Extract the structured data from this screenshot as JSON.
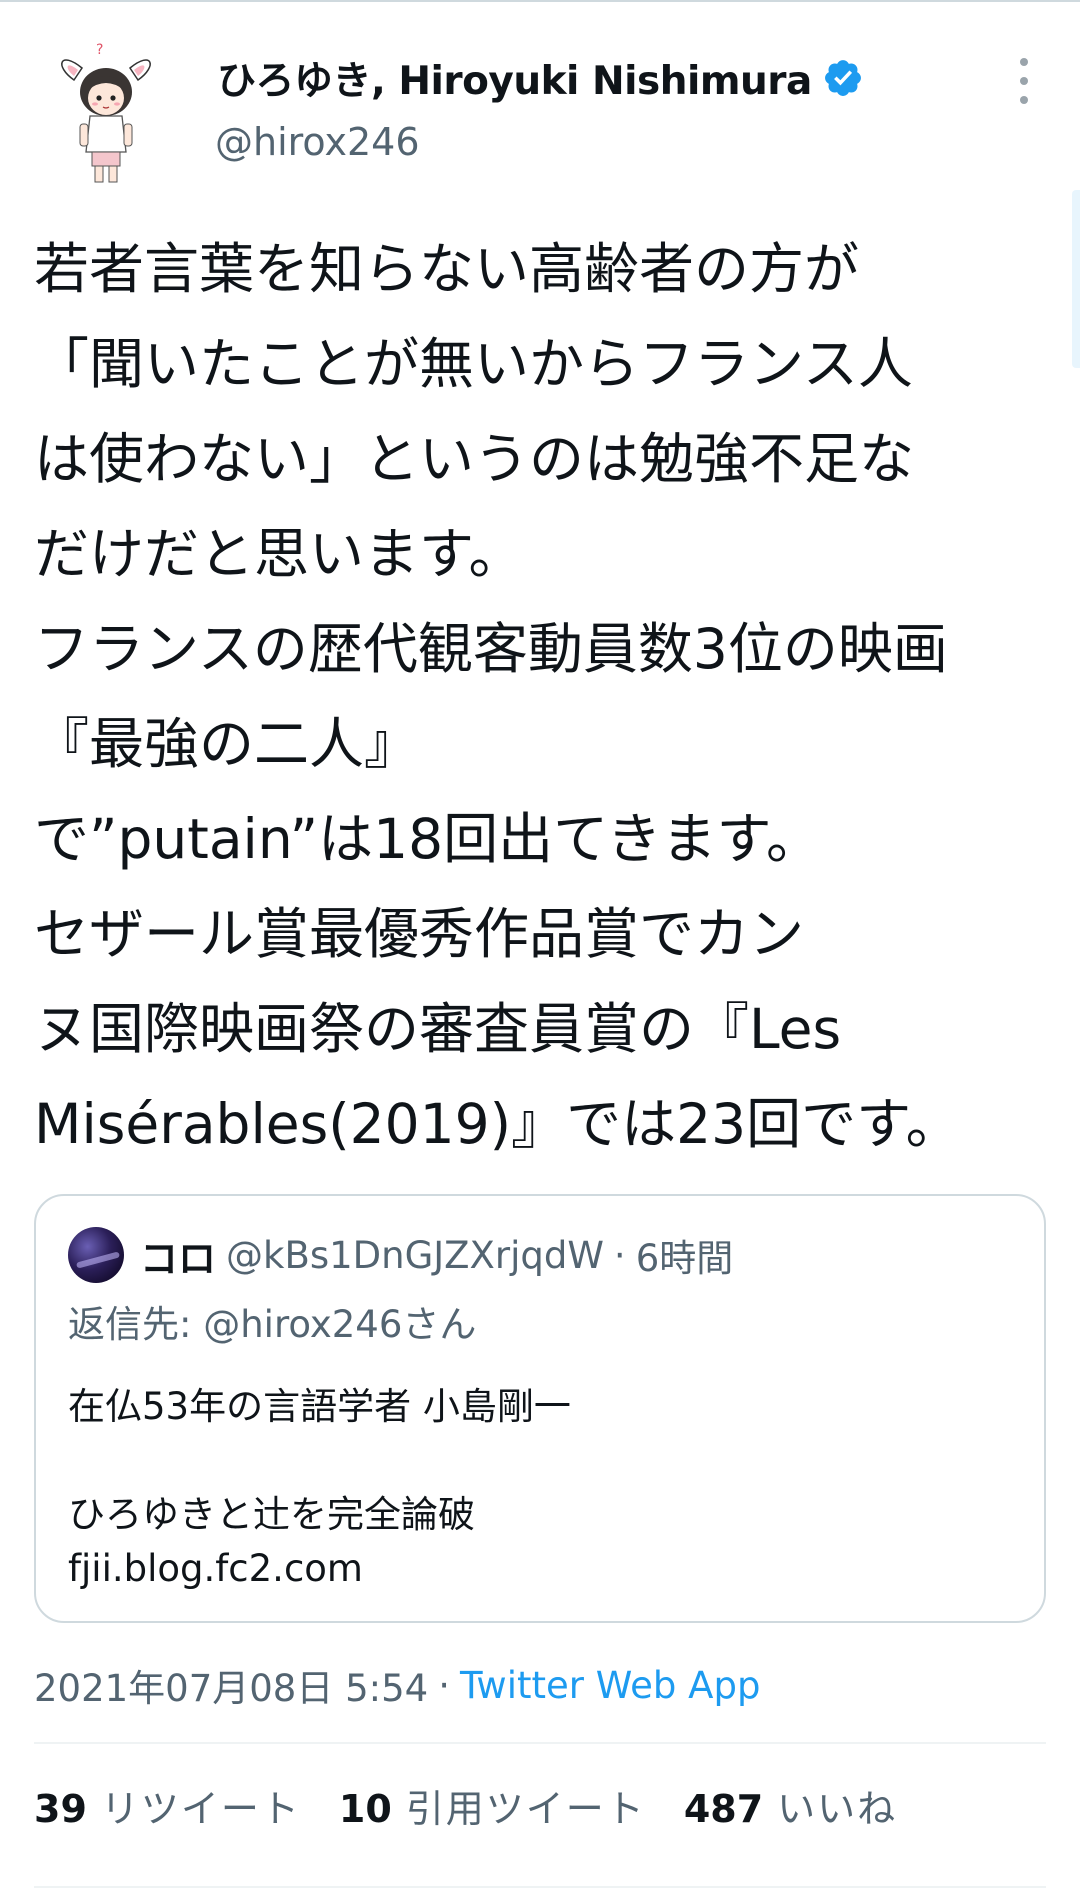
{
  "colors": {
    "accent": "#1d9bf0",
    "text": "#0f1419",
    "secondary": "#536471",
    "border": "#cfd9de"
  },
  "author": {
    "display_name": "ひろゆき, Hiroyuki Nishimura",
    "handle": "@hirox246",
    "verified_icon": "verified-badge-icon",
    "more_icon": "more-vertical-icon"
  },
  "tweet": {
    "text": "若者言葉を知らない高齢者の方が\n「聞いたことが無いからフランス人\nは使わない」というのは勉強不足な\nだけだと思います。\nフランスの歴代観客動員数3位の映画\n『最強の二人』\nで”putain”は18回出てきます。\nセザール賞最優秀作品賞でカン\nヌ国際映画祭の審査員賞の『Les\nMisérables(2019)』では23回です。"
  },
  "quote": {
    "name": "コロ",
    "handle": "@kBs1DnGJZXrjqdW",
    "separator": "·",
    "time": "6時間",
    "reply_to": "返信先: @hirox246さん",
    "body": "在仏53年の言語学者 小島剛一\n\nひろゆきと辻を完全論破\nfjii.blog.fc2.com"
  },
  "meta": {
    "timestamp": "2021年07月08日 5:54",
    "separator": "·",
    "source": "Twitter Web App"
  },
  "stats": [
    {
      "count": "39",
      "label": "リツイート"
    },
    {
      "count": "10",
      "label": "引用ツイート"
    },
    {
      "count": "487",
      "label": "いいね"
    }
  ]
}
